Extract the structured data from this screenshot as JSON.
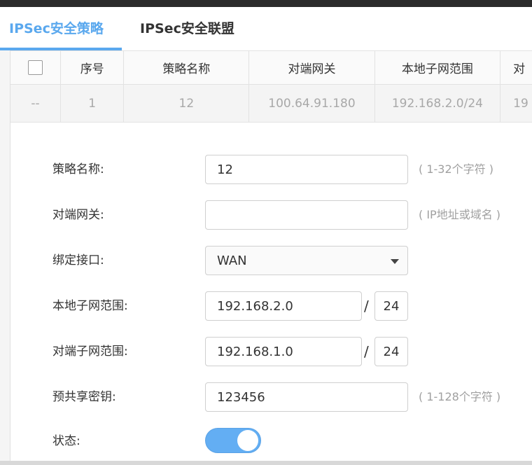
{
  "tabs": [
    {
      "label": "IPSec安全策略",
      "active": true
    },
    {
      "label": "IPSec安全联盟",
      "active": false
    }
  ],
  "table": {
    "headers": [
      "序号",
      "策略名称",
      "对端网关",
      "本地子网范围",
      "对"
    ],
    "row": [
      "--",
      "1",
      "12",
      "100.64.91.180",
      "192.168.2.0/24",
      "19"
    ]
  },
  "form": {
    "policy_name": {
      "label": "策略名称:",
      "value": "12",
      "hint": "( 1-32个字符 )"
    },
    "peer_gateway": {
      "label": "对端网关:",
      "value": "",
      "hint": "( IP地址或域名 )"
    },
    "bind_interface": {
      "label": "绑定接口:",
      "value": "WAN"
    },
    "local_subnet": {
      "label": "本地子网范围:",
      "ip": "192.168.2.0",
      "slash": "/",
      "mask": "24"
    },
    "peer_subnet": {
      "label": "对端子网范围:",
      "ip": "192.168.1.0",
      "slash": "/",
      "mask": "24"
    },
    "psk": {
      "label": "预共享密钥:",
      "value": "123456",
      "hint": "( 1-128个字符 )"
    },
    "status": {
      "label": "状态:",
      "enabled": true
    }
  },
  "colors": {
    "accent": "#5aa8ee",
    "toggle_on": "#63aef3"
  }
}
